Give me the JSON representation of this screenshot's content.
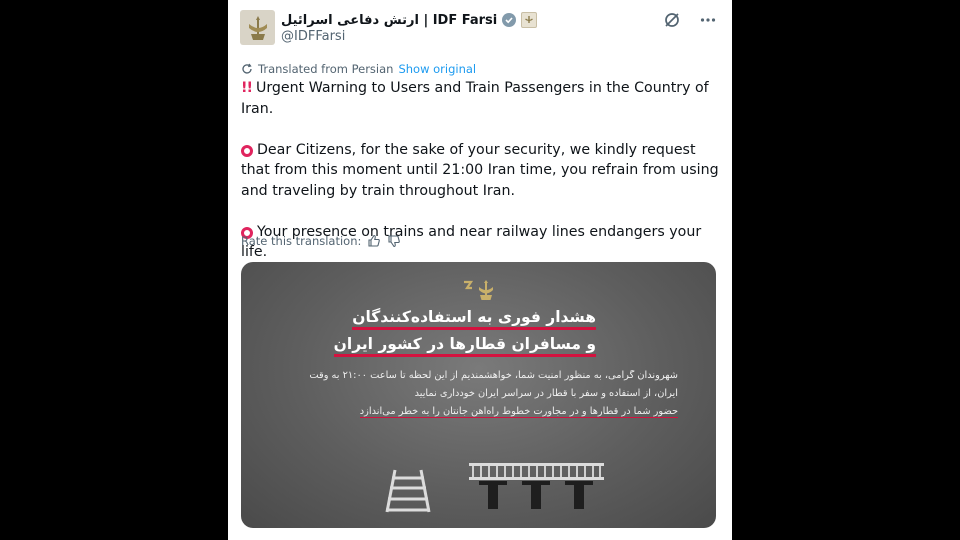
{
  "account": {
    "display_name": "ارتش دفاعی اسرائیل | IDF Farsi",
    "handle": "@IDFFarsi",
    "avatar_icon": "idf-emblem-icon",
    "verified_icon": "verified-check-icon",
    "affiliate_icon": "idf-emblem-icon"
  },
  "actions": {
    "grok_icon": "grok-icon",
    "more_icon": "more-horizontal-icon"
  },
  "translation": {
    "label": "Translated from Persian",
    "show_original": "Show original"
  },
  "tweet": {
    "line1": "Urgent Warning to Users and Train Passengers in the Country of Iran.",
    "line2": "Dear Citizens, for the sake of your security, we kindly request that from this moment until 21:00 Iran time, you refrain from using and traveling by train throughout Iran.",
    "line3": "Your presence on trains and near railway lines endangers your life."
  },
  "rate": {
    "label": "Rate this translation:"
  },
  "media": {
    "headline1": "هشدار فوری به استفاده‌کنندگان",
    "headline2": "و مسافران قطارها در کشور ایران",
    "body1": "شهروندان گرامی، به منظور امنیت شما، خواهشمندیم از این لحظه تا ساعت ۲۱:۰۰ به وقت",
    "body2": "ایران، از استفاده و سفر با قطار در سراسر ایران خودداری نمایید",
    "body3": "حضور شما در قطارها و در مجاورت خطوط راه‌آهن جانتان را به خطر می‌اندازد"
  },
  "colors": {
    "accent_link": "#1d9bf0",
    "warning_red": "#e0245e",
    "underline_red": "#d4123f",
    "text_primary": "#0f1419",
    "text_secondary": "#536471"
  }
}
